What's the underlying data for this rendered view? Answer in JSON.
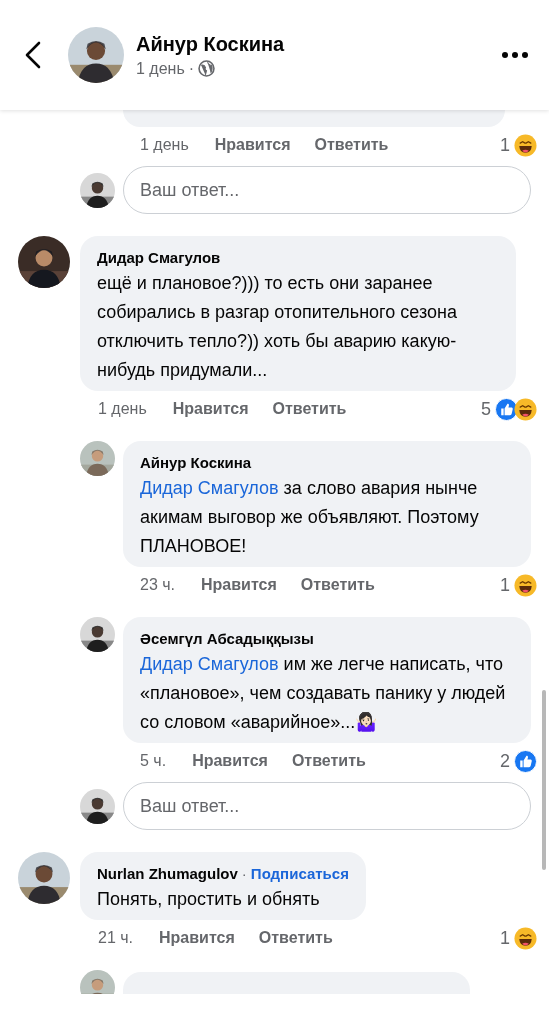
{
  "header": {
    "name": "Айнур Коскина",
    "time": "1 день",
    "separator": "·"
  },
  "comments": [
    {
      "kind": "cut",
      "time": "1 день",
      "like": "Нравится",
      "reply": "Ответить",
      "reaction_count": "1",
      "reactions": [
        {
          "kind": "haha"
        }
      ],
      "reply_box": {
        "placeholder": "Ваш ответ..."
      }
    },
    {
      "kind": "comment",
      "author": "Дидар Смагулов",
      "text": "ещё и плановое?))) то есть они заранее собирались в разгар отопительного сезона отключить тепло?)) хоть бы аварию какую-нибудь придумали...",
      "time": "1 день",
      "like": "Нравится",
      "reply": "Ответить",
      "reaction_count": "5",
      "reactions": [
        {
          "kind": "like"
        },
        {
          "kind": "haha"
        }
      ],
      "children": [
        {
          "kind": "comment",
          "author": "Айнур Коскина",
          "mention": "Дидар Смагулов",
          "text": "за слово авария нынче акимам выговор же объявляют. Поэтому ПЛАНОВОЕ!",
          "time": "23 ч.",
          "like": "Нравится",
          "reply": "Ответить",
          "reaction_count": "1",
          "reactions": [
            {
              "kind": "haha"
            }
          ]
        },
        {
          "kind": "comment",
          "author": "Әсемгүл Абсадыққызы",
          "mention": "Дидар Смагулов",
          "text": "им же легче написать, что «плановое», чем создавать панику у людей со словом «аварийное»...🤷🏻‍♀️",
          "time": "5 ч.",
          "like": "Нравится",
          "reply": "Ответить",
          "reaction_count": "2",
          "reactions": [
            {
              "kind": "like"
            }
          ]
        }
      ],
      "reply_box": {
        "placeholder": "Ваш ответ..."
      }
    },
    {
      "kind": "comment",
      "author": "Nurlan Zhumagulov",
      "separator": "·",
      "follow": "Подписаться",
      "text": "Понять, простить и обнять",
      "time": "21 ч.",
      "like": "Нравится",
      "reply": "Ответить",
      "reaction_count": "1",
      "reactions": [
        {
          "kind": "haha"
        }
      ],
      "children": [
        {
          "kind": "partial"
        }
      ]
    }
  ]
}
